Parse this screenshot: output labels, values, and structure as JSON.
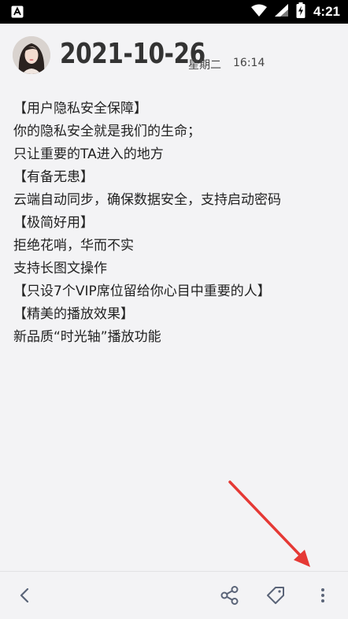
{
  "status_bar": {
    "time": "4:21",
    "icons": [
      "app-notification-icon",
      "wifi-icon",
      "signal-icon",
      "battery-charging-icon"
    ]
  },
  "entry": {
    "date": "2021-10-26",
    "weekday": "星期二",
    "time": "16:14",
    "lines": [
      "【用户隐私安全保障】",
      "你的隐私安全就是我们的生命；",
      "只让重要的TA进入的地方",
      "【有备无患】",
      "云端自动同步，确保数据安全，支持启动密码",
      "【极简好用】",
      "拒绝花哨，华而不实",
      "支持长图文操作",
      "【只设7个VIP席位留给你心目中重要的人】",
      "【精美的播放效果】",
      "新品质“时光轴”播放功能"
    ]
  },
  "bottom_bar": {
    "icons": [
      "back-arrow-icon",
      "share-icon",
      "tag-icon",
      "more-vert-icon"
    ]
  },
  "colors": {
    "background": "#f3f3f5",
    "text": "#222222",
    "icon": "#5a6478",
    "annotation_arrow": "#e53935"
  }
}
